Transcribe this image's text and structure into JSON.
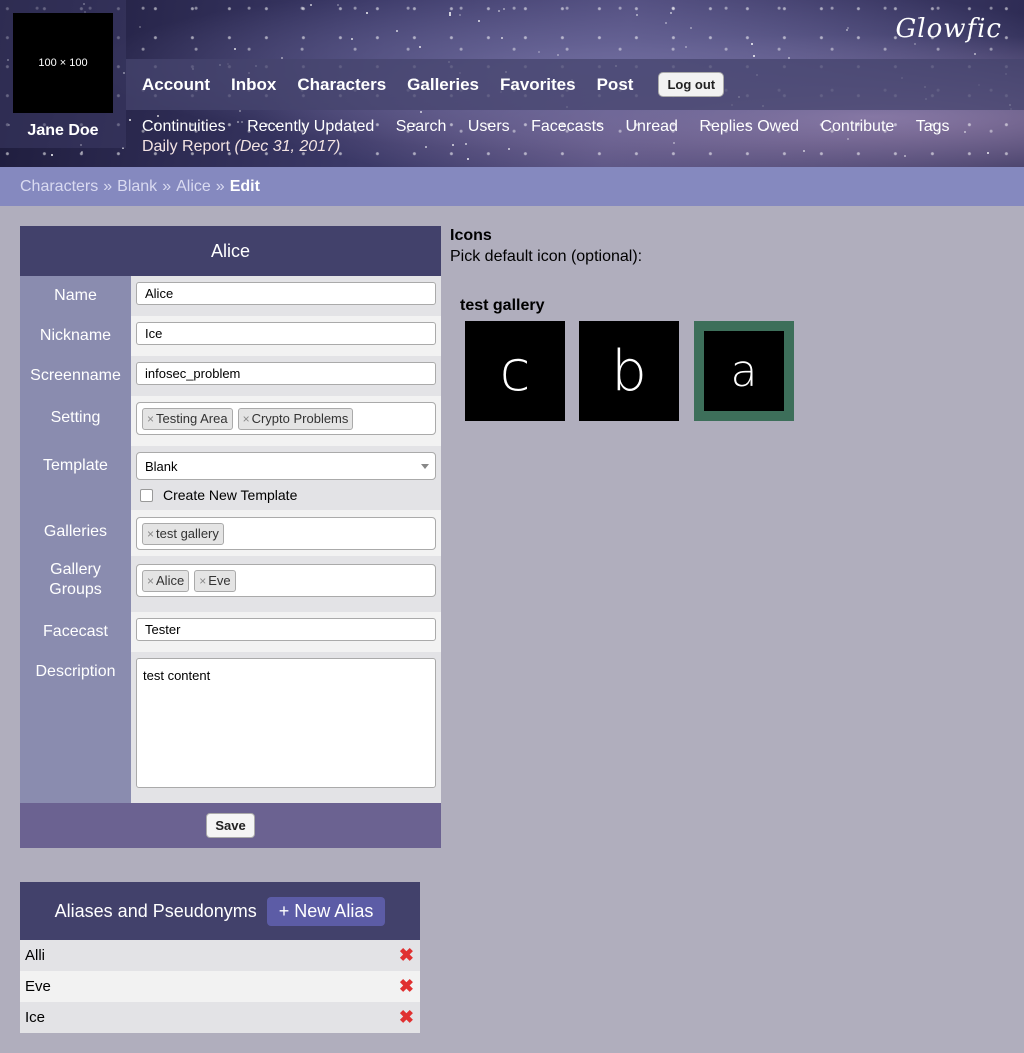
{
  "header": {
    "avatar_text": "100 × 100",
    "username": "Jane Doe",
    "logo": "Glowfic",
    "main_nav": [
      "Account",
      "Inbox",
      "Characters",
      "Galleries",
      "Favorites",
      "Post"
    ],
    "logout_label": "Log out",
    "sub_nav": [
      "Continuities",
      "Recently Updated",
      "Search",
      "Users",
      "Facecasts",
      "Unread",
      "Replies Owed",
      "Contribute",
      "Tags"
    ],
    "daily_report_label": "Daily Report",
    "daily_report_date": "(Dec 31, 2017)"
  },
  "breadcrumb": {
    "items": [
      "Characters",
      "Blank",
      "Alice"
    ],
    "separator": "»",
    "current": "Edit"
  },
  "form": {
    "title": "Alice",
    "name_label": "Name",
    "name_value": "Alice",
    "nickname_label": "Nickname",
    "nickname_value": "Ice",
    "screenname_label": "Screenname",
    "screenname_value": "infosec_problem",
    "setting_label": "Setting",
    "setting_tags": [
      "Testing Area",
      "Crypto Problems"
    ],
    "template_label": "Template",
    "template_value": "Blank",
    "create_template_label": "Create New Template",
    "galleries_label": "Galleries",
    "gallery_tags": [
      "test gallery"
    ],
    "gallery_groups_label": "Gallery Groups",
    "gallery_group_tags": [
      "Alice",
      "Eve"
    ],
    "facecast_label": "Facecast",
    "facecast_value": "Tester",
    "description_label": "Description",
    "description_value": "test content",
    "save_label": "Save",
    "tag_remove_glyph": "×"
  },
  "icons": {
    "heading": "Icons",
    "subheading": "Pick default icon (optional):",
    "gallery_name": "test gallery",
    "items": [
      {
        "keyword": "c",
        "selected": false
      },
      {
        "keyword": "b",
        "selected": false
      },
      {
        "keyword": "a",
        "selected": true
      }
    ],
    "selected_border_color": "#3d6f5a"
  },
  "aliases": {
    "heading": "Aliases and Pseudonyms",
    "new_label": "+ New Alias",
    "items": [
      "Alli",
      "Eve",
      "Ice"
    ],
    "delete_glyph": "✖"
  },
  "colors": {
    "page_bg": "#b0aebd",
    "panel_header": "#42416b",
    "label_bg": "#8a8caf",
    "breadcrumb_bg": "#8589bf",
    "footer_bg": "#6b6291",
    "accent_button": "#5c5ca6"
  }
}
